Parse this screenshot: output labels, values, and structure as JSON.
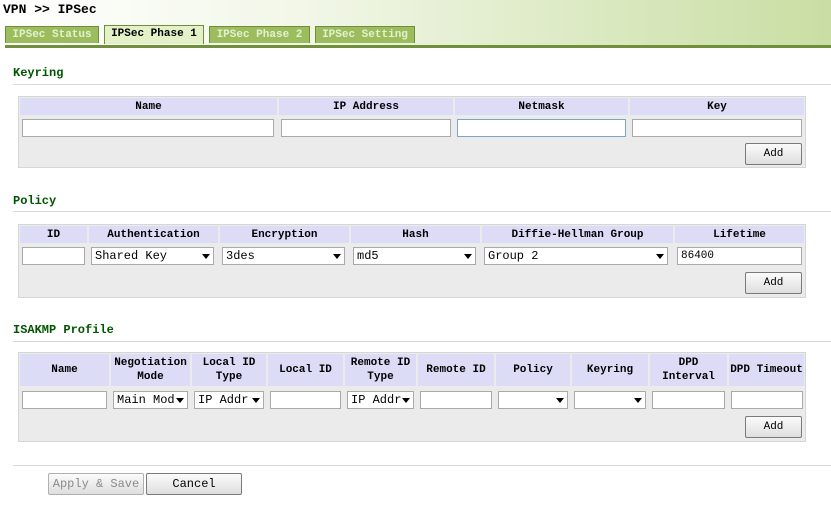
{
  "page": {
    "title": "VPN >> IPSec"
  },
  "tabs": [
    {
      "label": "IPSec Status"
    },
    {
      "label": "IPSec Phase 1"
    },
    {
      "label": "IPSec Phase 2"
    },
    {
      "label": "IPSec Setting"
    }
  ],
  "keyring": {
    "title": "Keyring",
    "columns": [
      "Name",
      "IP Address",
      "Netmask",
      "Key"
    ],
    "add_label": "Add"
  },
  "policy": {
    "title": "Policy",
    "columns": [
      "ID",
      "Authentication",
      "Encryption",
      "Hash",
      "Diffie-Hellman Group",
      "Lifetime"
    ],
    "values": {
      "authentication": "Shared Key",
      "encryption": "3des",
      "hash": "md5",
      "dh_group": "Group 2",
      "lifetime": "86400"
    },
    "add_label": "Add"
  },
  "isakmp": {
    "title": "ISAKMP Profile",
    "columns": [
      "Name",
      "Negotiation Mode",
      "Local ID Type",
      "Local ID",
      "Remote ID Type",
      "Remote ID",
      "Policy",
      "Keyring",
      "DPD Interval",
      "DPD Timeout"
    ],
    "values": {
      "negotiation_mode": "Main Mod",
      "local_id_type": "IP Addr",
      "remote_id_type": "IP Addr"
    },
    "add_label": "Add"
  },
  "footer": {
    "apply_label": "Apply & Save",
    "cancel_label": "Cancel"
  },
  "colors": {
    "header_green": "#c9dea3",
    "tab_green": "#9bbd5e",
    "section_title": "#005500",
    "table_header": "#dcdcf7"
  }
}
